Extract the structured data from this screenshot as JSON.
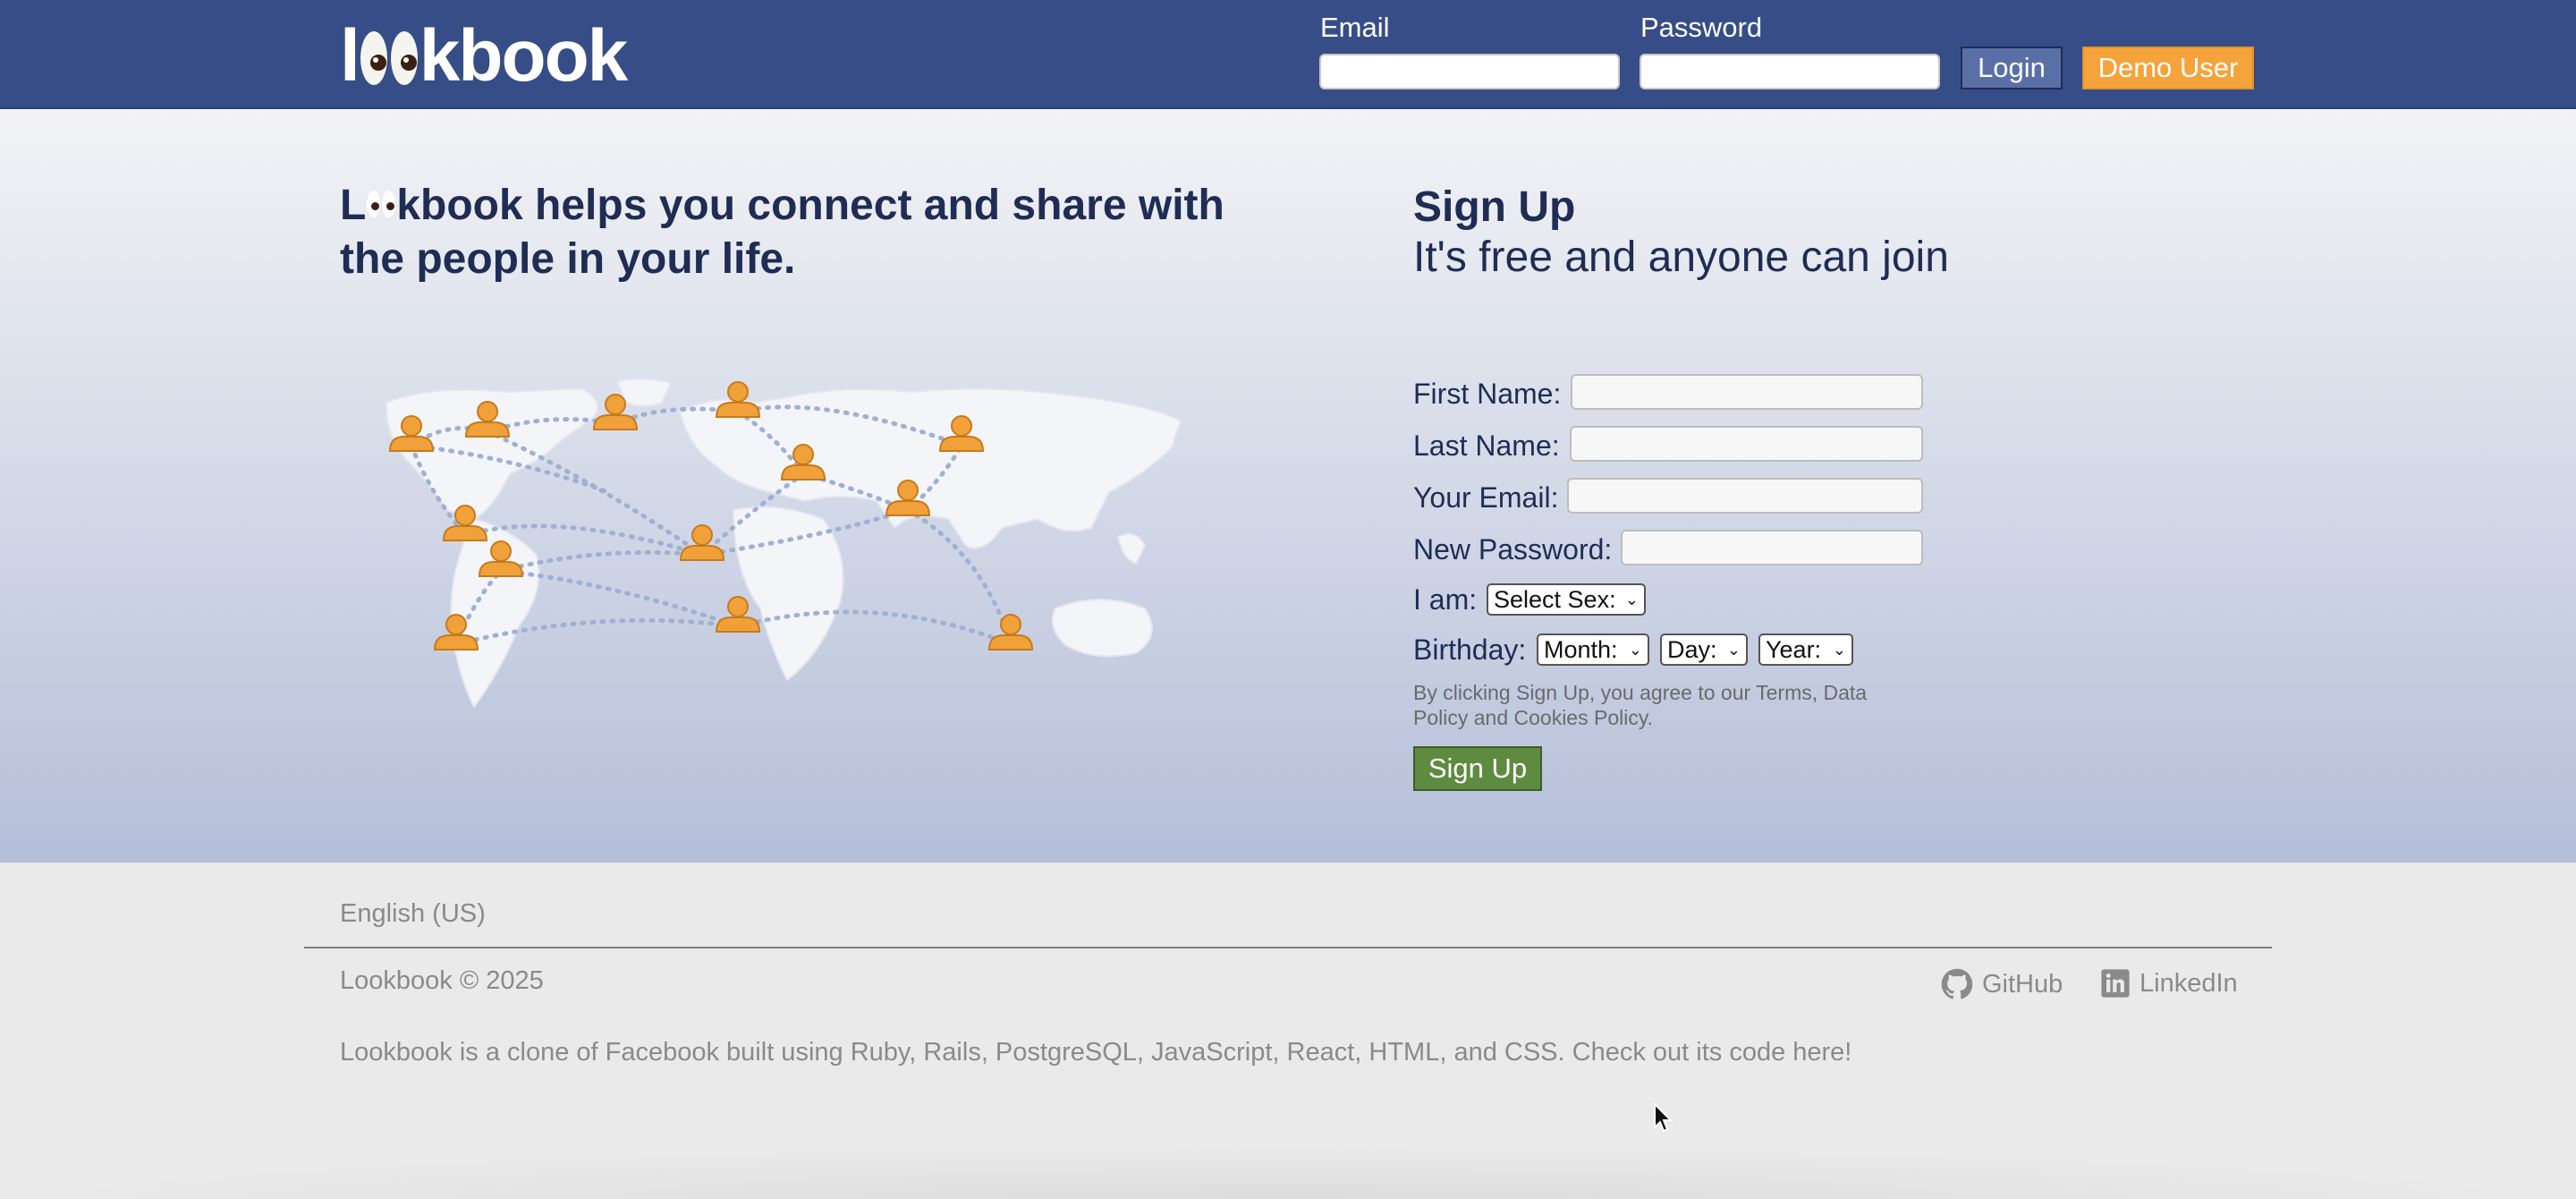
{
  "header": {
    "logo_prefix": "l",
    "logo_suffix": "kbook",
    "email_label": "Email",
    "password_label": "Password",
    "login_label": "Login",
    "demo_label": "Demo User",
    "colors": {
      "bar": "#374d87",
      "demo": "#f6a33b"
    }
  },
  "hero": {
    "tagline_l": "L",
    "tagline_rest": "kbook helps you connect and share with the people in your life."
  },
  "signup": {
    "title": "Sign Up",
    "subtitle": "It's free and anyone can join",
    "first_name_label": "First Name:",
    "last_name_label": "Last Name:",
    "email_label": "Your Email:",
    "password_label": "New Password:",
    "sex_label": "I am:",
    "sex_select": "Select Sex:",
    "birthday_label": "Birthday:",
    "month_select": "Month:",
    "day_select": "Day:",
    "year_select": "Year:",
    "terms": "By clicking Sign Up, you agree to our Terms, Data Policy and Cookies Policy.",
    "submit_label": "Sign Up",
    "colors": {
      "submit": "#5e8b3f"
    }
  },
  "footer": {
    "language": "English (US)",
    "copyright": "Lookbook © 2025",
    "github": "GitHub",
    "linkedin": "LinkedIn",
    "about": "Lookbook is a clone of Facebook built using Ruby, Rails, PostgreSQL, JavaScript, React, HTML, and CSS. Check out its code here!"
  }
}
